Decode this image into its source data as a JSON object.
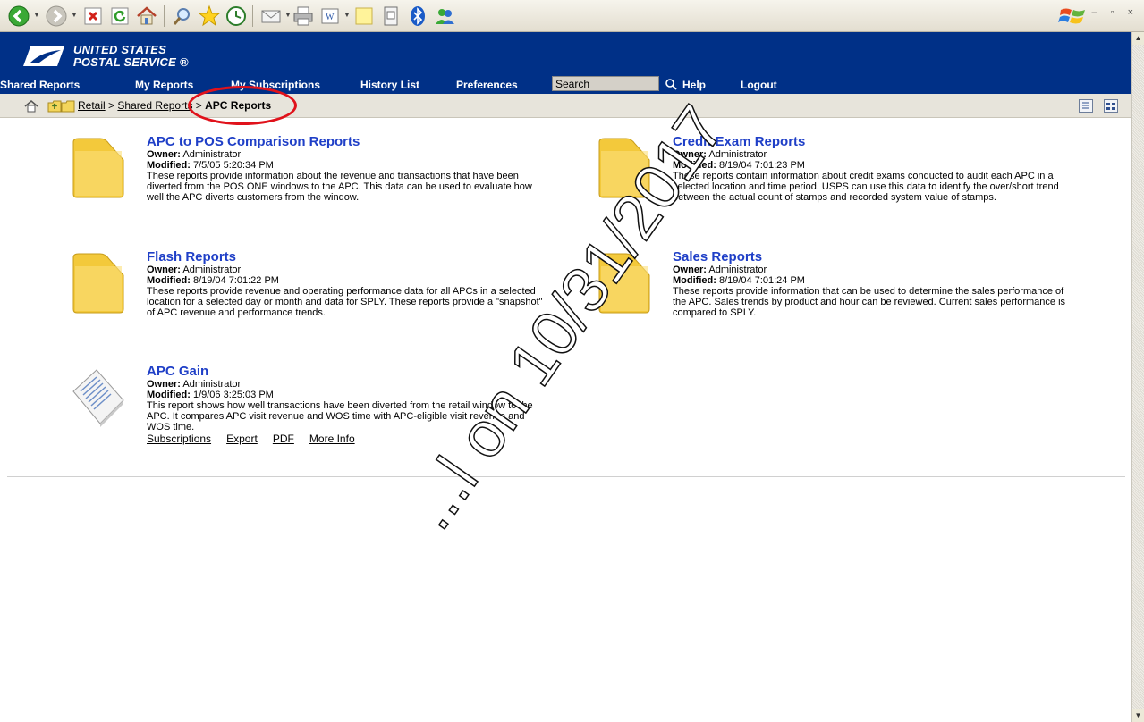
{
  "browser_toolbar": {
    "icons": [
      "back-icon",
      "forward-icon",
      "stop-icon",
      "refresh-icon",
      "home-icon",
      "search-icon",
      "favorites-icon",
      "history-icon",
      "mail-icon",
      "print-icon",
      "edit-icon",
      "notes-icon",
      "messenger-icon",
      "bluetooth-icon",
      "msn-people-icon"
    ],
    "window_controls": "– ▫ ×"
  },
  "brand": {
    "line1": "UNITED STATES",
    "line2": "POSTAL SERVICE ®"
  },
  "nav": {
    "shared_reports": "Shared Reports",
    "my_reports": "My Reports",
    "my_subscriptions": "My Subscriptions",
    "history_list": "History List",
    "preferences": "Preferences",
    "search_value": "Search",
    "help": "Help",
    "logout": "Logout"
  },
  "breadcrumb": {
    "retail": "Retail",
    "sep": ">",
    "shared_reports": "Shared Reports",
    "current": "APC Reports"
  },
  "items": [
    {
      "title": "APC to POS Comparison Reports",
      "owner_label": "Owner:",
      "owner": "Administrator",
      "modified_label": "Modified:",
      "modified": "7/5/05 5:20:34 PM",
      "desc": "These reports provide information about the revenue and transactions that have been diverted from the POS ONE windows to the APC. This data can be used to evaluate how well the APC diverts customers from the window.",
      "icon": "folder-icon"
    },
    {
      "title": "Credit Exam Reports",
      "owner_label": "Owner:",
      "owner": "Administrator",
      "modified_label": "Modified:",
      "modified": "8/19/04 7:01:23 PM",
      "desc": "These reports contain information about credit exams conducted to audit each APC in a selected location and time period. USPS can use this data to identify the over/short trend between the actual count of stamps and recorded system value of stamps.",
      "icon": "folder-icon"
    },
    {
      "title": "Flash Reports",
      "owner_label": "Owner:",
      "owner": "Administrator",
      "modified_label": "Modified:",
      "modified": "8/19/04 7:01:22 PM",
      "desc": "These reports provide revenue and operating performance data for all APCs in a selected location for a selected day or month and data for SPLY. These reports provide a \"snapshot\" of APC revenue and performance trends.",
      "icon": "folder-icon"
    },
    {
      "title": "Sales Reports",
      "owner_label": "Owner:",
      "owner": "Administrator",
      "modified_label": "Modified:",
      "modified": "8/19/04 7:01:24 PM",
      "desc": "These reports provide information that can be used to determine the sales performance of the APC.  Sales trends by product and hour can be reviewed. Current sales performance is compared to SPLY.",
      "icon": "folder-icon"
    },
    {
      "title": "APC Gain",
      "owner_label": "Owner:",
      "owner": "Administrator",
      "modified_label": "Modified:",
      "modified": "1/9/06 3:25:03 PM",
      "desc": "This report shows how well transactions have been diverted from the retail window to the APC. It compares APC visit revenue and WOS time with APC-eligible visit revenue and WOS time.",
      "icon": "report-document-icon",
      "links": {
        "subscriptions": "Subscriptions",
        "export": "Export",
        "pdf": "PDF",
        "more_info": "More Info"
      }
    }
  ],
  "watermark": "...l on 10/31/2017",
  "colors": {
    "header_bg": "#003087",
    "title_link": "#1f3fc7",
    "annotation_circle": "#e0121b"
  }
}
